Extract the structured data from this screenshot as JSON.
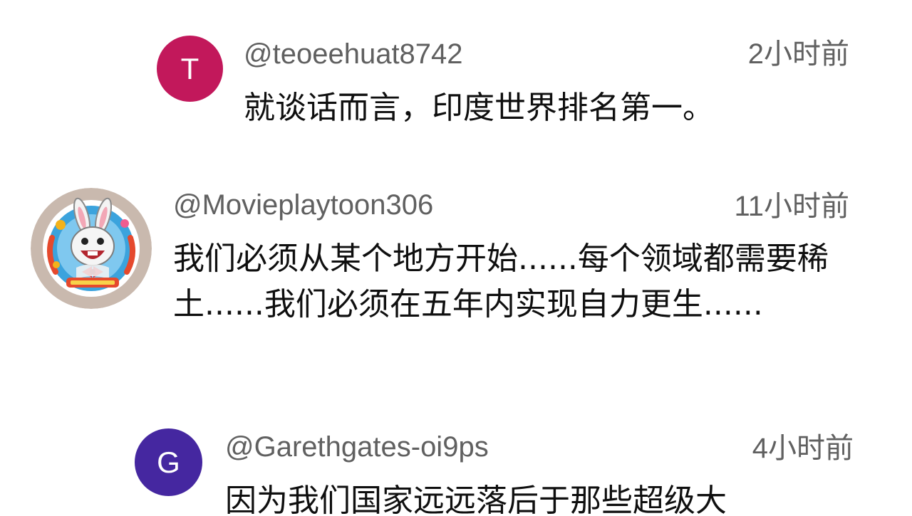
{
  "comments": [
    {
      "avatar_letter": "T",
      "avatar_color": "#c2185b",
      "handle": "@teoeehuat8742",
      "time": "2小时前",
      "text": "就谈话而言，印度世界排名第一。"
    },
    {
      "avatar_icon": "cartoon-bunny-avatar-icon",
      "handle": "@Movieplaytoon306",
      "time": "11小时前",
      "text": "我们必须从某个地方开始......每个领域都需要稀土......我们必须在五年内实现自力更生......"
    },
    {
      "avatar_letter": "G",
      "avatar_color": "#4527a0",
      "handle": "@Garethgates-oi9ps",
      "time": "4小时前",
      "text": "因为我们国家远远落后于那些超级大"
    }
  ]
}
